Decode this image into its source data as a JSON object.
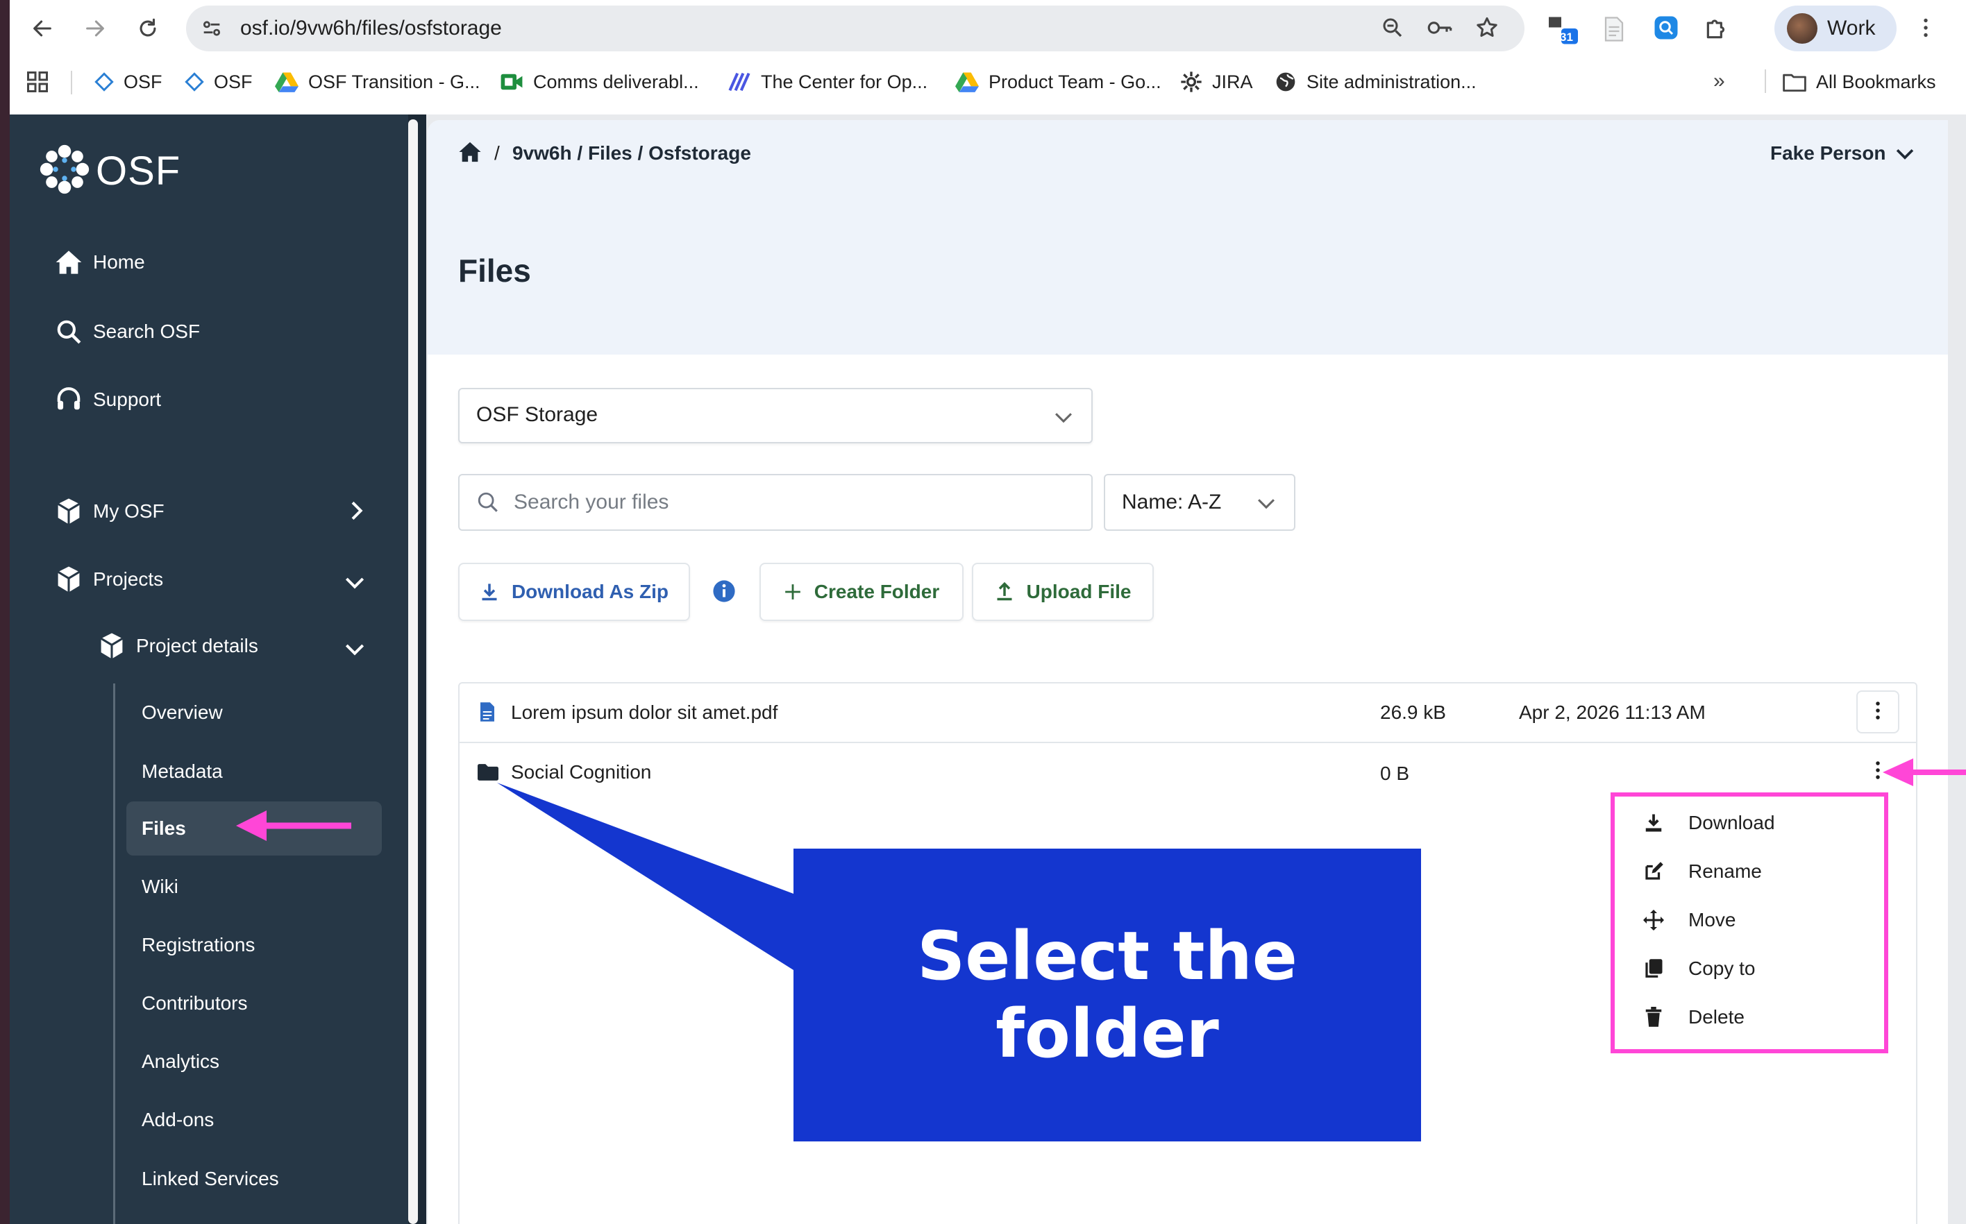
{
  "browser": {
    "url": "osf.io/9vw6h/files/osfstorage",
    "profile_label": "Work",
    "calendar_badge": "31",
    "bookmarks": [
      {
        "label": "OSF"
      },
      {
        "label": "OSF"
      },
      {
        "label": "OSF Transition - G..."
      },
      {
        "label": "Comms deliverabl..."
      },
      {
        "label": "The Center for Op..."
      },
      {
        "label": "Product Team - Go..."
      },
      {
        "label": "JIRA"
      },
      {
        "label": "Site administration..."
      }
    ],
    "all_bookmarks": "All Bookmarks"
  },
  "sidebar": {
    "logo_text": "OSF",
    "nav": [
      {
        "label": "Home",
        "icon": "home-icon"
      },
      {
        "label": "Search OSF",
        "icon": "search-icon"
      },
      {
        "label": "Support",
        "icon": "headset-icon"
      },
      {
        "label": "My OSF",
        "icon": "cube-icon"
      },
      {
        "label": "Projects",
        "icon": "cube-icon"
      },
      {
        "label": "Project details",
        "icon": "cube-icon"
      }
    ],
    "sub_items": [
      "Overview",
      "Metadata",
      "Files",
      "Wiki",
      "Registrations",
      "Contributors",
      "Analytics",
      "Add-ons",
      "Linked Services"
    ],
    "active_item": "Files"
  },
  "header": {
    "breadcrumb": "9vw6h / Files / Osfstorage",
    "breadcrumb_sep": "/",
    "user_name": "Fake Person",
    "page_title": "Files"
  },
  "toolbar": {
    "storage_select": "OSF Storage",
    "search_placeholder": "Search your files",
    "sort_select": "Name: A-Z",
    "download_zip": "Download As Zip",
    "create_folder": "Create Folder",
    "upload_file": "Upload File"
  },
  "files": [
    {
      "name": "Lorem ipsum dolor sit amet.pdf",
      "size": "26.9 kB",
      "modified": "Apr 2, 2026 11:13 AM",
      "type": "file"
    },
    {
      "name": "Social Cognition",
      "size": "0 B",
      "modified": "",
      "type": "folder"
    }
  ],
  "context_menu": {
    "items": [
      {
        "label": "Download",
        "icon": "download-icon"
      },
      {
        "label": "Rename",
        "icon": "edit-icon"
      },
      {
        "label": "Move",
        "icon": "move-icon"
      },
      {
        "label": "Copy to",
        "icon": "copy-icon"
      },
      {
        "label": "Delete",
        "icon": "trash-icon"
      }
    ]
  },
  "annotation": {
    "callout_line1": "Select the",
    "callout_line2": "folder",
    "colors": {
      "callout": "#1436cf",
      "highlight": "#ff46d7"
    }
  },
  "colors": {
    "sidebar": "#263746",
    "header_bg": "#eef3fa",
    "action_blue": "#2f5fb0",
    "action_green": "#2e6b3a"
  }
}
